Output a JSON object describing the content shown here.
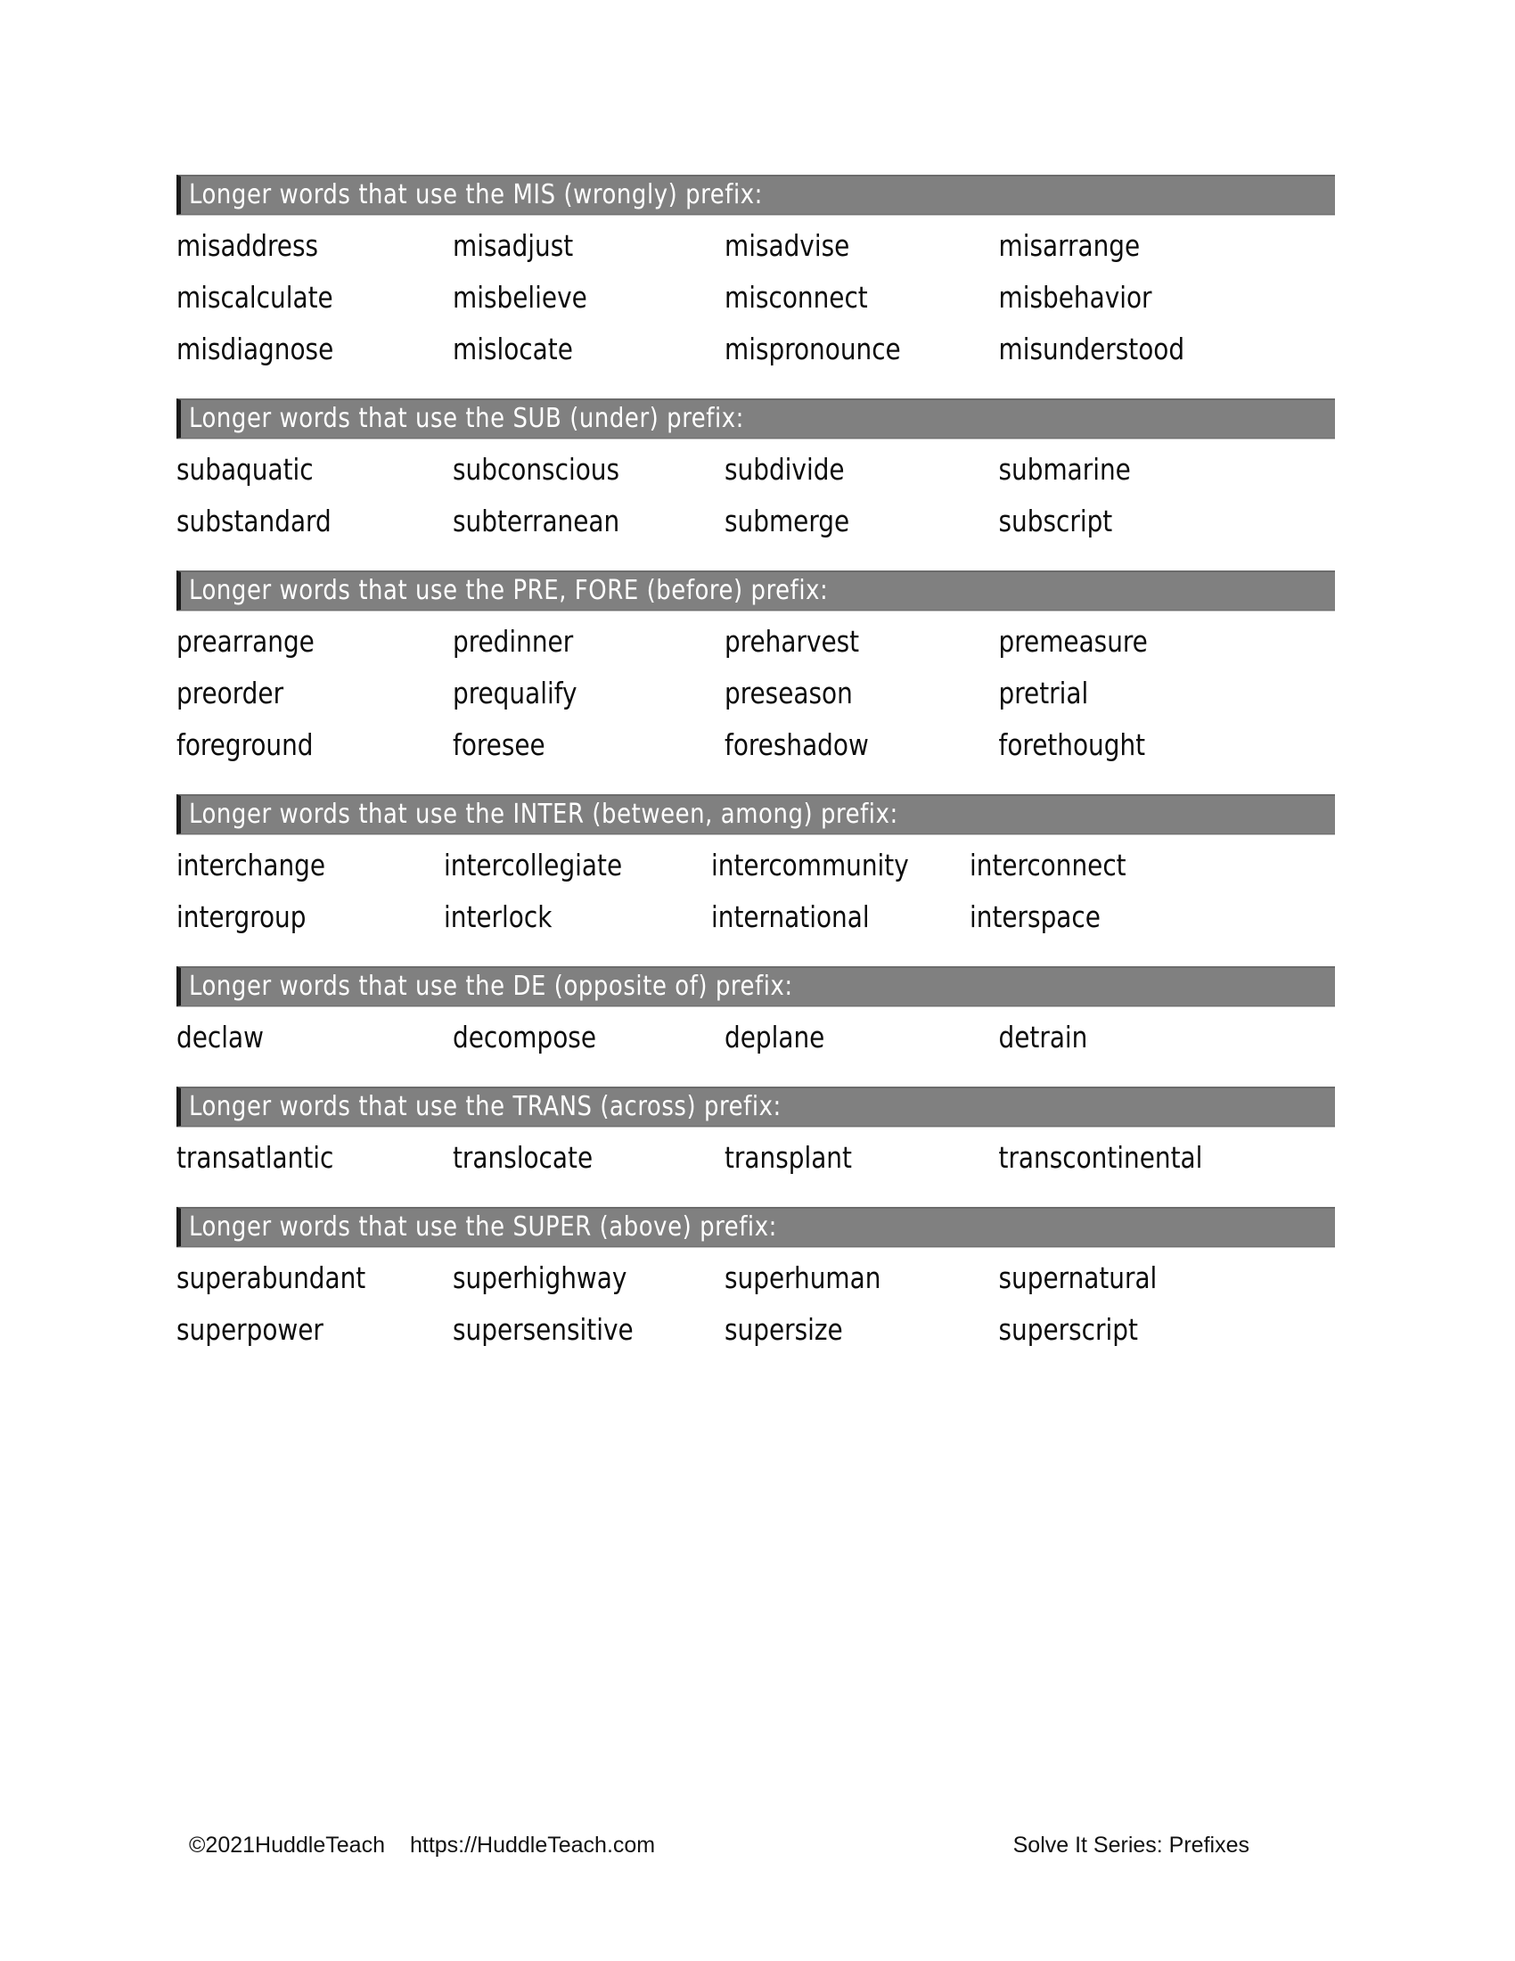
{
  "document": {
    "title": "Solve It Series: Prefixes"
  },
  "sections": [
    {
      "heading": "Longer words that use the MIS (wrongly) prefix:",
      "prefix": "MIS",
      "meaning": "wrongly",
      "words": [
        [
          "misaddress",
          "misadjust",
          "misadvise",
          "misarrange"
        ],
        [
          "miscalculate",
          "misbelieve",
          "misconnect",
          "misbehavior"
        ],
        [
          "misdiagnose",
          "mislocate",
          "mispronounce",
          "misunderstood"
        ]
      ]
    },
    {
      "heading": "Longer words that use the SUB (under) prefix:",
      "prefix": "SUB",
      "meaning": "under",
      "words": [
        [
          "subaquatic",
          "subconscious",
          "subdivide",
          "submarine"
        ],
        [
          "substandard",
          "subterranean",
          "submerge",
          "subscript"
        ]
      ]
    },
    {
      "heading": "Longer words that use the PRE, FORE (before) prefix:",
      "prefix": "PRE, FORE",
      "meaning": "before",
      "words": [
        [
          "prearrange",
          "predinner",
          "preharvest",
          "premeasure"
        ],
        [
          "preorder",
          "prequalify",
          "preseason",
          "pretrial"
        ],
        [
          "foreground",
          "foresee",
          "foreshadow",
          "forethought"
        ]
      ]
    },
    {
      "heading": "Longer words that use the INTER (between, among) prefix:",
      "prefix": "INTER",
      "meaning": "between, among",
      "words": [
        [
          "interchange",
          "intercollegiate",
          "intercommunity",
          "interconnect"
        ],
        [
          "intergroup",
          "interlock",
          "international",
          "interspace"
        ]
      ]
    },
    {
      "heading": "Longer words that use the DE (opposite of) prefix:",
      "prefix": "DE",
      "meaning": "opposite of",
      "words": [
        [
          "declaw",
          "decompose",
          "deplane",
          "detrain"
        ]
      ]
    },
    {
      "heading": "Longer words that use the TRANS (across) prefix:",
      "prefix": "TRANS",
      "meaning": "across",
      "words": [
        [
          "transatlantic",
          "translocate",
          "transplant",
          "transcontinental"
        ]
      ]
    },
    {
      "heading": "Longer words that use the SUPER (above) prefix:",
      "prefix": "SUPER",
      "meaning": "above",
      "words": [
        [
          "superabundant",
          "superhighway",
          "superhuman",
          "supernatural"
        ],
        [
          "superpower",
          "supersensitive",
          "supersize",
          "superscript"
        ]
      ]
    }
  ],
  "footer": {
    "copyright": "©2021HuddleTeach",
    "url": "https://HuddleTeach.com",
    "series": "Solve It Series: Prefixes"
  },
  "colors": {
    "bar_background": "#808080",
    "bar_text": "#ffffff",
    "bar_border": "#1a1a1a",
    "body_text": "#0d0d0d",
    "page_background": "#ffffff"
  }
}
